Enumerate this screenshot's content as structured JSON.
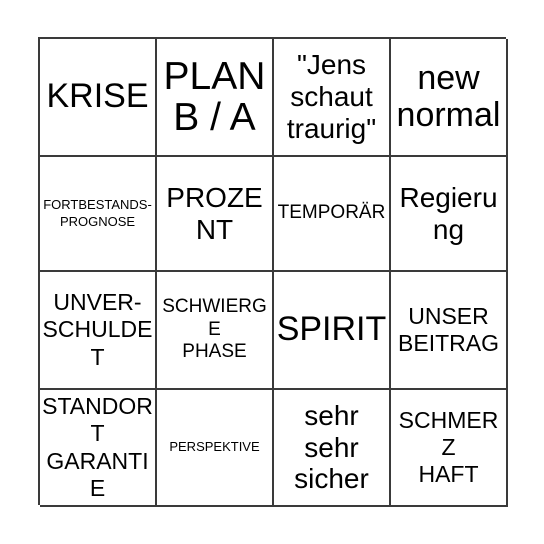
{
  "card": {
    "type": "bingo-card",
    "columns": 4,
    "rows": 4,
    "border_color": "#3a3a3a",
    "background_color": "#ffffff",
    "text_color": "#000000",
    "cells": [
      {
        "text": "KRISE",
        "size": "lg",
        "row": 1,
        "col": 1
      },
      {
        "text": "PLAN\nB / A",
        "size": "xl",
        "row": 1,
        "col": 2
      },
      {
        "text": "\"Jens\nschaut\ntraurig\"",
        "size": "md",
        "row": 1,
        "col": 3
      },
      {
        "text": "new\nnormal",
        "size": "lg",
        "row": 1,
        "col": 4
      },
      {
        "text": "FORTBESTANDS-\nPROGNOSE",
        "size": "xxs",
        "row": 2,
        "col": 1
      },
      {
        "text": "PROZENT",
        "size": "md",
        "row": 2,
        "col": 2
      },
      {
        "text": "TEMPORÄR",
        "size": "xs",
        "row": 2,
        "col": 3
      },
      {
        "text": "Regierung",
        "size": "md",
        "row": 2,
        "col": 4
      },
      {
        "text": "UNVER-\nSCHULDET",
        "size": "sm",
        "row": 3,
        "col": 1
      },
      {
        "text": "SCHWIERGE\nPHASE",
        "size": "xs",
        "row": 3,
        "col": 2
      },
      {
        "text": "SPIRIT",
        "size": "lg",
        "row": 3,
        "col": 3
      },
      {
        "text": "UNSER\nBEITRAG",
        "size": "sm",
        "row": 3,
        "col": 4
      },
      {
        "text": "STANDORT\nGARANTIE",
        "size": "sm",
        "row": 4,
        "col": 1
      },
      {
        "text": "PERSPEKTIVE",
        "size": "xxs",
        "row": 4,
        "col": 2
      },
      {
        "text": "sehr\nsehr\nsicher",
        "size": "md",
        "row": 4,
        "col": 3
      },
      {
        "text": "SCHMERZ\nHAFT",
        "size": "sm",
        "row": 4,
        "col": 4
      }
    ]
  }
}
